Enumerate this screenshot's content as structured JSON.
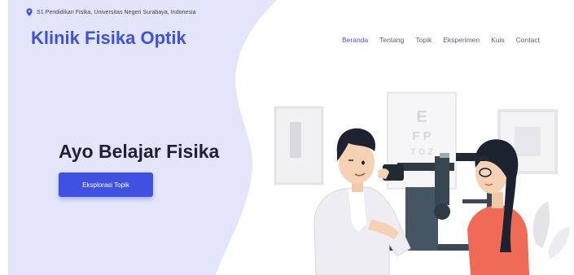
{
  "topbar": {
    "address": "S1 Pendidikan Fisika, Universitas Negeri Surabaya, Indonesia"
  },
  "brand": {
    "name": "Klinik Fisika Optik"
  },
  "nav": {
    "items": [
      {
        "label": "Beranda",
        "active": true
      },
      {
        "label": "Tentang"
      },
      {
        "label": "Topik"
      },
      {
        "label": "Eksperimen"
      },
      {
        "label": "Kuis"
      },
      {
        "label": "Contact"
      }
    ]
  },
  "hero": {
    "title": "Ayo Belajar Fisika",
    "cta_label": "Eksplorasi Topik"
  },
  "chart_letters": {
    "row1": "E",
    "row2": "F P",
    "row3": "T O Z"
  },
  "colors": {
    "accent": "#3f51e0",
    "blob": "#e3e6fb",
    "title": "#1e1f3b"
  },
  "icons": {
    "location": "location-pin-icon"
  }
}
